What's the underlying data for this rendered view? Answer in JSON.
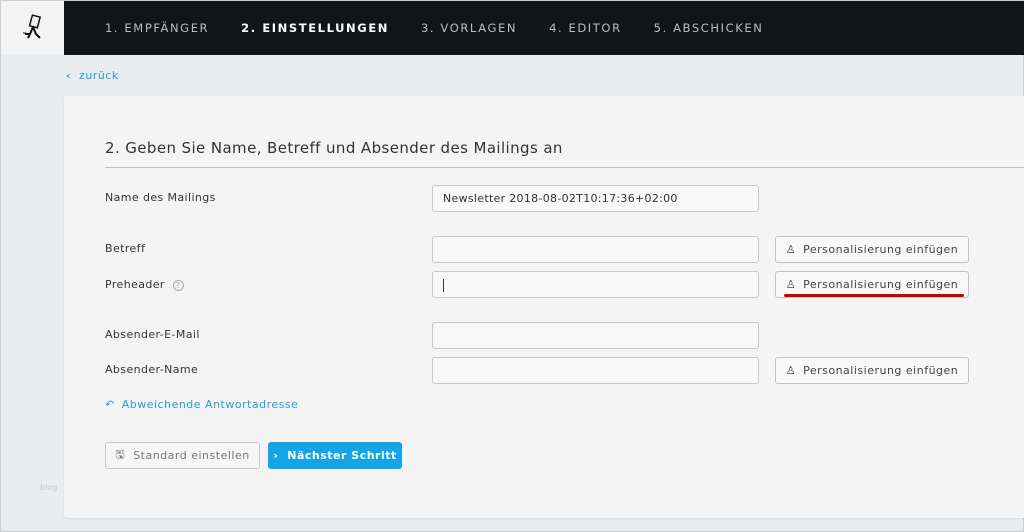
{
  "nav": {
    "steps": [
      "1. EMPFÄNGER",
      "2. EINSTELLUNGEN",
      "3. VORLAGEN",
      "4. EDITOR",
      "5. ABSCHICKEN"
    ],
    "active_index": 1
  },
  "back_label": "zurück",
  "heading": "2. Geben Sie Name, Betreff und Absender des Mailings an",
  "fields": {
    "name": {
      "label": "Name des Mailings",
      "value": "Newsletter 2018-08-02T10:17:36+02:00"
    },
    "betreff": {
      "label": "Betreff",
      "value": ""
    },
    "preheader": {
      "label": "Preheader",
      "value": ""
    },
    "absender_email": {
      "label": "Absender-E-Mail",
      "value": ""
    },
    "absender_name": {
      "label": "Absender-Name",
      "value": ""
    }
  },
  "personalize_label": "Personalisierung einfügen",
  "reply_link": "Abweichende Antwortadresse",
  "buttons": {
    "standard": "Standard einstellen",
    "next": "Nächster Schritt"
  },
  "side_text": "blog",
  "colors": {
    "accent": "#14a4e8",
    "link": "#2b9ad8",
    "highlight": "#cc0000"
  }
}
